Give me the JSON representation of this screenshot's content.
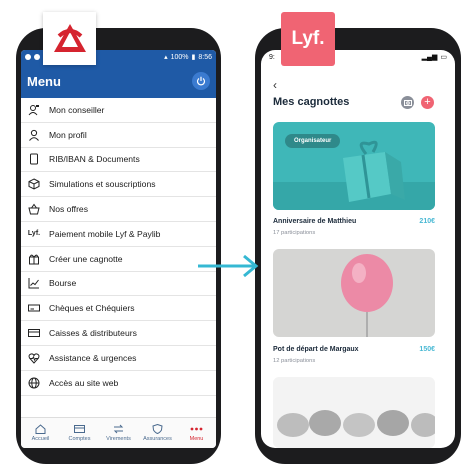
{
  "left_phone": {
    "status_bar": {
      "battery": "100%",
      "time": "8:56"
    },
    "header": {
      "title": "Menu"
    },
    "menu_items": [
      {
        "label": "Mon conseiller",
        "icon": "advisor-icon"
      },
      {
        "label": "Mon profil",
        "icon": "user-icon"
      },
      {
        "label": "RIB/IBAN & Documents",
        "icon": "document-icon"
      },
      {
        "label": "Simulations et souscriptions",
        "icon": "cube-icon"
      },
      {
        "label": "Nos offres",
        "icon": "basket-icon"
      },
      {
        "label": "Paiement mobile Lyf & Paylib",
        "icon": "lyf-logo-icon"
      },
      {
        "label": "Créer une cagnotte",
        "icon": "gift-icon"
      },
      {
        "label": "Bourse",
        "icon": "chart-icon"
      },
      {
        "label": "Chèques et Chéquiers",
        "icon": "cheque-icon"
      },
      {
        "label": "Caisses & distributeurs",
        "icon": "atm-icon"
      },
      {
        "label": "Assistance & urgences",
        "icon": "heartbeat-icon"
      },
      {
        "label": "Accès au site web",
        "icon": "globe-icon"
      }
    ],
    "bottom_nav": [
      {
        "label": "Accueil",
        "icon": "home-icon",
        "active": false
      },
      {
        "label": "Comptes",
        "icon": "card-icon",
        "active": false
      },
      {
        "label": "Virements",
        "icon": "transfer-icon",
        "active": false
      },
      {
        "label": "Assurances",
        "icon": "shield-icon",
        "active": false
      },
      {
        "label": "Menu",
        "icon": "more-dots-icon",
        "active": true
      }
    ]
  },
  "logos": {
    "lyf": "Lyf."
  },
  "right_phone": {
    "status_bar": {
      "time": "9:"
    },
    "back": "‹",
    "title": "Mes cagnottes",
    "cards": [
      {
        "name": "Anniversaire de Matthieu",
        "amount": "210€",
        "participations": "17 participations",
        "badge": "Organisateur"
      },
      {
        "name": "Pot de départ de Margaux",
        "amount": "150€",
        "participations": "12 participations"
      }
    ]
  },
  "colors": {
    "brand_blue": "#1f5aa6",
    "accent_red": "#d5242f",
    "lyf_pink": "#f06473",
    "teal": "#4ab9d4"
  }
}
